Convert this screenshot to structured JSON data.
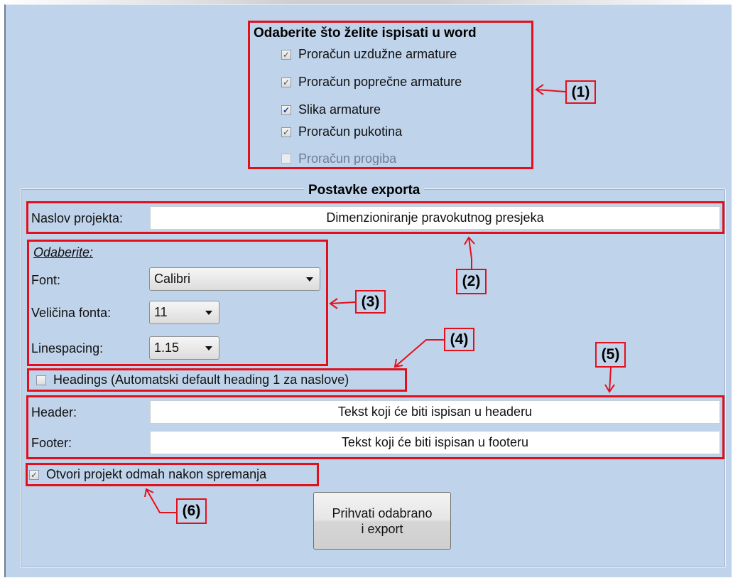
{
  "word_section": {
    "heading": "Odaberite što želite ispisati u word",
    "options": [
      {
        "label": "Proračun uzdužne armature",
        "checked": true,
        "enabled": true
      },
      {
        "label": "Proračun poprečne armature",
        "checked": true,
        "enabled": true
      },
      {
        "label": "Slika armature",
        "checked": true,
        "enabled": true
      },
      {
        "label": "Proračun pukotina",
        "checked": true,
        "enabled": true
      },
      {
        "label": "Proračun progiba",
        "checked": false,
        "enabled": false
      }
    ]
  },
  "export_settings": {
    "title": "Postavke exporta",
    "project_title_label": "Naslov projekta:",
    "project_title_value": "Dimenzioniranje pravokutnog presjeka",
    "choose_label": "Odaberite:",
    "font_label": "Font:",
    "font_value": "Calibri",
    "font_size_label": "Veličina fonta:",
    "font_size_value": "11",
    "linespacing_label": "Linespacing:",
    "linespacing_value": "1.15",
    "headings_label": "Headings (Automatski default heading 1 za naslove)",
    "headings_checked": false,
    "header_label": "Header:",
    "header_value": "Tekst koji će biti ispisan u headeru",
    "footer_label": "Footer:",
    "footer_value": "Tekst koji će biti ispisan u footeru",
    "open_project_label": "Otvori projekt odmah nakon spremanja",
    "open_project_checked": true,
    "accept_button_line1": "Prihvati odabrano",
    "accept_button_line2": "i export"
  },
  "annotations": [
    "(1)",
    "(2)",
    "(3)",
    "(4)",
    "(5)",
    "(6)"
  ],
  "colors": {
    "window_bg": "#bfd3ea",
    "annotation_red": "#e3101c"
  },
  "icons": {
    "checkbox_checked": "✓"
  }
}
